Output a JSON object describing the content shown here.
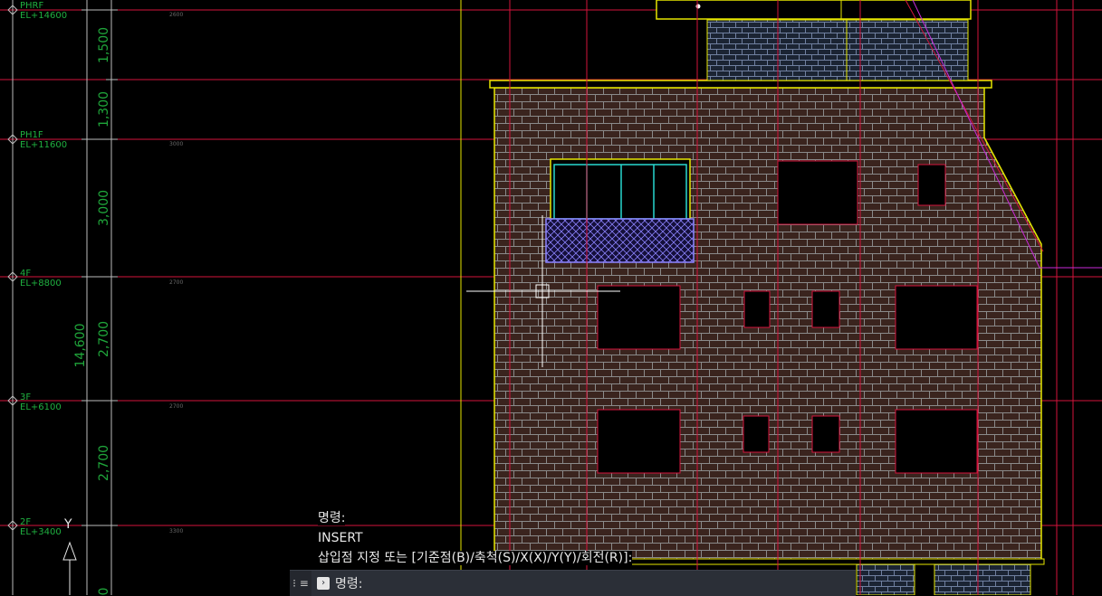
{
  "levels": [
    {
      "name": "PHRF",
      "elev": "EL+14600"
    },
    {
      "name": "PH1F",
      "elev": "EL+11600"
    },
    {
      "name": "4F",
      "elev": "EL+8800"
    },
    {
      "name": "3F",
      "elev": "EL+6100"
    },
    {
      "name": "2F",
      "elev": "EL+3400"
    }
  ],
  "dimensions": {
    "seg_1": "1,500",
    "seg_2": "1,300",
    "seg_3": "3,000",
    "seg_4": "2,700",
    "seg_5": "2,700",
    "total": "14,600",
    "bottom": "0"
  },
  "small_labels": {
    "s1": "2600",
    "s2": "3000",
    "s3": "2700",
    "s4": "2700",
    "s5": "3300"
  },
  "ucs": {
    "y_label": "Y"
  },
  "command_history": {
    "line1": "명령:",
    "line2": "INSERT",
    "line3": "삽입점 지정 또는 [기준점(B)/축척(S)/X(X)/Y(Y)/회전(R)]:"
  },
  "command_line": {
    "prompt_label": "명령:",
    "value": "",
    "prompt_icon": "command-prompt-icon",
    "grip_icon": "grip-icon",
    "menu_icon": "hamburger-icon"
  },
  "colors": {
    "background": "#000000",
    "brick": "#3a241e",
    "mortar": "#8a8a8a",
    "outline": "#e6e600",
    "gridline": "#d4143c",
    "dim_text": "#1fa53a",
    "level_text": "#1fb040",
    "window_frame": "#29d9d0",
    "railing": "#8d84ff",
    "diagonal": "#c82ad8"
  }
}
